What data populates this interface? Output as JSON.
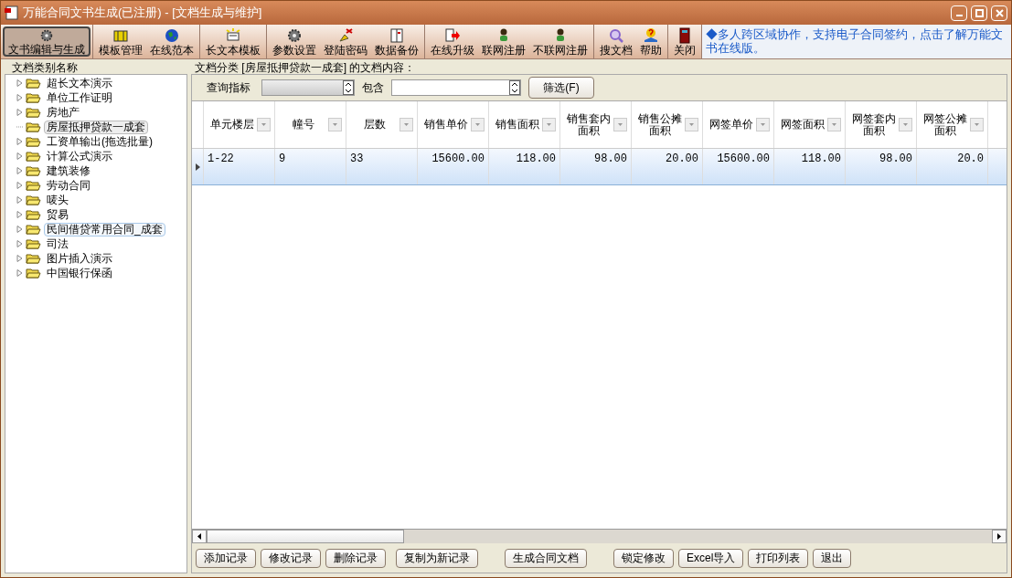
{
  "window": {
    "title": "万能合同文书生成(已注册) - [文档生成与维护]"
  },
  "toolbar": {
    "groups": [
      [
        {
          "label": "文书编辑与生成",
          "selected": true
        }
      ],
      [
        {
          "label": "模板管理",
          "selected": false
        },
        {
          "label": "在线范本",
          "selected": false
        }
      ],
      [
        {
          "label": "长文本模板",
          "selected": false
        }
      ],
      [
        {
          "label": "参数设置",
          "selected": false
        },
        {
          "label": "登陆密码",
          "selected": false
        },
        {
          "label": "数据备份",
          "selected": false
        }
      ],
      [
        {
          "label": "在线升级",
          "selected": false
        },
        {
          "label": "联网注册",
          "selected": false
        },
        {
          "label": "不联网注册",
          "selected": false
        }
      ],
      [
        {
          "label": "搜文档",
          "selected": false
        },
        {
          "label": "帮助",
          "selected": false
        }
      ],
      [
        {
          "label": "关闭",
          "selected": false
        }
      ]
    ],
    "promo": "◆多人跨区域协作，支持电子合同签约，点击了解万能文书在线版。"
  },
  "sidebar": {
    "title": "文档类别名称",
    "items": [
      {
        "label": "超长文本演示",
        "selected": false,
        "hover": false,
        "expandable": true
      },
      {
        "label": "单位工作证明",
        "selected": false,
        "hover": false,
        "expandable": true
      },
      {
        "label": "房地产",
        "selected": false,
        "hover": false,
        "expandable": true
      },
      {
        "label": "房屋抵押贷款一成套",
        "selected": true,
        "hover": false,
        "expandable": false
      },
      {
        "label": "工资单输出(拖选批量)",
        "selected": false,
        "hover": false,
        "expandable": true
      },
      {
        "label": "计算公式演示",
        "selected": false,
        "hover": false,
        "expandable": true
      },
      {
        "label": "建筑装修",
        "selected": false,
        "hover": false,
        "expandable": true
      },
      {
        "label": "劳动合同",
        "selected": false,
        "hover": false,
        "expandable": true
      },
      {
        "label": "唛头",
        "selected": false,
        "hover": false,
        "expandable": true
      },
      {
        "label": "贸易",
        "selected": false,
        "hover": false,
        "expandable": true
      },
      {
        "label": "民间借贷常用合同_成套",
        "selected": false,
        "hover": true,
        "expandable": true
      },
      {
        "label": "司法",
        "selected": false,
        "hover": false,
        "expandable": true
      },
      {
        "label": "图片插入演示",
        "selected": false,
        "hover": false,
        "expandable": true
      },
      {
        "label": "中国银行保函",
        "selected": false,
        "hover": false,
        "expandable": true
      }
    ]
  },
  "content": {
    "title": "文档分类 [房屋抵押贷款一成套] 的文档内容：",
    "filter": {
      "label": "查询指标",
      "contains_label": "包含",
      "button": "筛选(F)"
    },
    "table": {
      "columns": [
        {
          "label": "单元楼层"
        },
        {
          "label": "幢号"
        },
        {
          "label": "层数"
        },
        {
          "label": "销售单价"
        },
        {
          "label": "销售面积"
        },
        {
          "label": "销售套内面积"
        },
        {
          "label": "销售公摊面积"
        },
        {
          "label": "网签单价"
        },
        {
          "label": "网签面积"
        },
        {
          "label": "网签套内面积"
        },
        {
          "label": "网签公摊面积"
        }
      ],
      "rows": [
        {
          "selected": true,
          "cells": [
            "1-22",
            "9",
            "33",
            "15600.00",
            "118.00",
            "98.00",
            "20.00",
            "15600.00",
            "118.00",
            "98.00",
            "20.0"
          ]
        }
      ]
    },
    "buttons": [
      "添加记录",
      "修改记录",
      "删除记录",
      "复制为新记录",
      "生成合同文档",
      "锁定修改",
      "Excel导入",
      "打印列表",
      "退出"
    ]
  }
}
